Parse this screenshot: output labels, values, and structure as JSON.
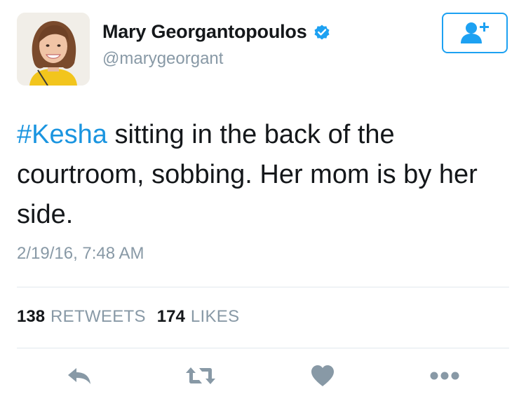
{
  "user": {
    "display_name": "Mary Georgantopoulos",
    "handle": "@marygeorgant",
    "verified": true
  },
  "follow_button": {
    "icon": "add-user-icon"
  },
  "tweet": {
    "hashtag": "#Kesha",
    "text": " sitting in the back of the courtroom, sobbing. Her mom is by her side.",
    "timestamp": "2/19/16, 7:48 AM"
  },
  "stats": {
    "retweets_count": "138",
    "retweets_label": "RETWEETS",
    "likes_count": "174",
    "likes_label": "LIKES"
  },
  "actions": {
    "reply_icon": "reply-icon",
    "retweet_icon": "retweet-icon",
    "like_icon": "heart-icon",
    "more_icon": "more-icon"
  },
  "colors": {
    "accent": "#1da1f2",
    "hashtag": "#1b95e0",
    "secondary_text": "#8899a6",
    "icon_gray": "#8899a6",
    "divider": "#e1e8ed"
  }
}
